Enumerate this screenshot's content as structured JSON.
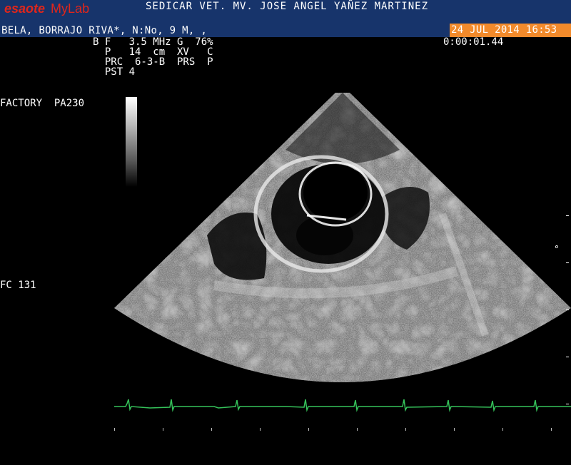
{
  "header": {
    "brand": "esaote",
    "brand_product": "MyLab",
    "clinic": "SEDICAR VET. MV. JOSE ANGEL YAÑEZ MARTINEZ",
    "patient": "BELA, BORRAJO RIVA*, N:No, 9 M, ,",
    "datetime": "24 JUL 2014 16:53"
  },
  "params": {
    "line1": "B F   3.5 MHz G  76%",
    "line2": "  P   14  cm  XV   C",
    "line3": "  PRC  6-3-B  PRS  P",
    "line4": "  PST 4"
  },
  "timer": "0:00:01.44",
  "preset": "FACTORY  PA230",
  "heart_rate": "FC 131",
  "focus_marker": "°",
  "colors": {
    "header_bg": "#17346b",
    "date_bg": "#f28a2b",
    "brand_red": "#e0261b",
    "ecg_trace": "#35c25a",
    "image_bg": "#000000"
  },
  "icons": {
    "grayscale_bar": "grayscale-bar-icon",
    "ecg": "ecg-trace-icon"
  }
}
